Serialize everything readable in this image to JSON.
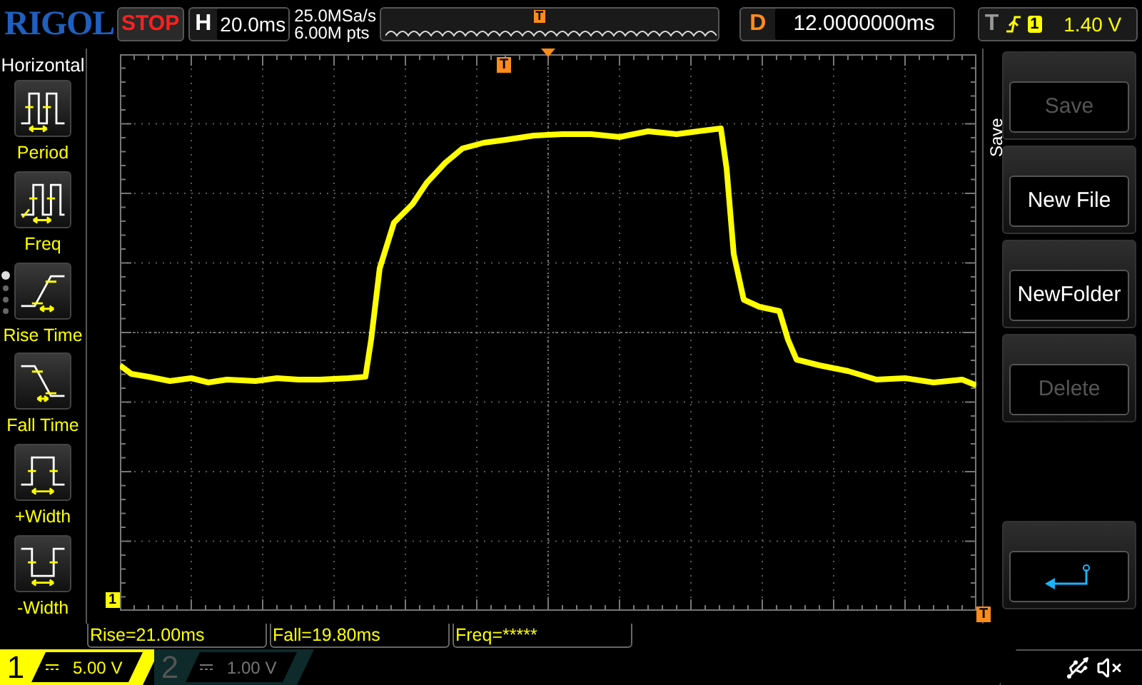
{
  "brand": "RIGOL",
  "run_state": "STOP",
  "horizontal": {
    "label": "H",
    "timebase": "20.0ms"
  },
  "sample_rate": "25.0MSa/s",
  "memory_depth": "6.00M pts",
  "overview_trigger_marker": "T",
  "delay": {
    "label": "D",
    "value": "12.0000000ms"
  },
  "trigger": {
    "label": "T",
    "source": "1",
    "level": "1.40 V"
  },
  "left_menu": {
    "title": "Horizontal",
    "items": [
      {
        "label": "Period",
        "kind": "period"
      },
      {
        "label": "Freq",
        "kind": "freq"
      },
      {
        "label": "Rise Time",
        "kind": "rise"
      },
      {
        "label": "Fall Time",
        "kind": "fall"
      },
      {
        "label": "+Width",
        "kind": "pwidth"
      },
      {
        "label": "-Width",
        "kind": "nwidth"
      }
    ],
    "pages": [
      {
        "selected": true
      },
      {
        "selected": false
      },
      {
        "selected": false
      },
      {
        "selected": false
      }
    ]
  },
  "trigger_position_marker": "T",
  "trigger_level_marker": "T",
  "channel_marker": "1",
  "right_menu": {
    "title": "Save",
    "items": [
      {
        "kind": "button",
        "label": "Save",
        "disabled": true
      },
      {
        "kind": "button",
        "label": "New File",
        "disabled": false
      },
      {
        "kind": "button",
        "label": "NewFolder",
        "disabled": false
      },
      {
        "kind": "button",
        "label": "Delete",
        "disabled": true
      },
      {
        "kind": "back"
      }
    ]
  },
  "measurements": [
    "Rise=21.00ms",
    "Fall=19.80ms",
    "Freq=*****"
  ],
  "channels": [
    {
      "number": "1",
      "scale": "5.00 V",
      "on": true
    },
    {
      "number": "2",
      "scale": "1.00 V",
      "on": false
    }
  ]
}
